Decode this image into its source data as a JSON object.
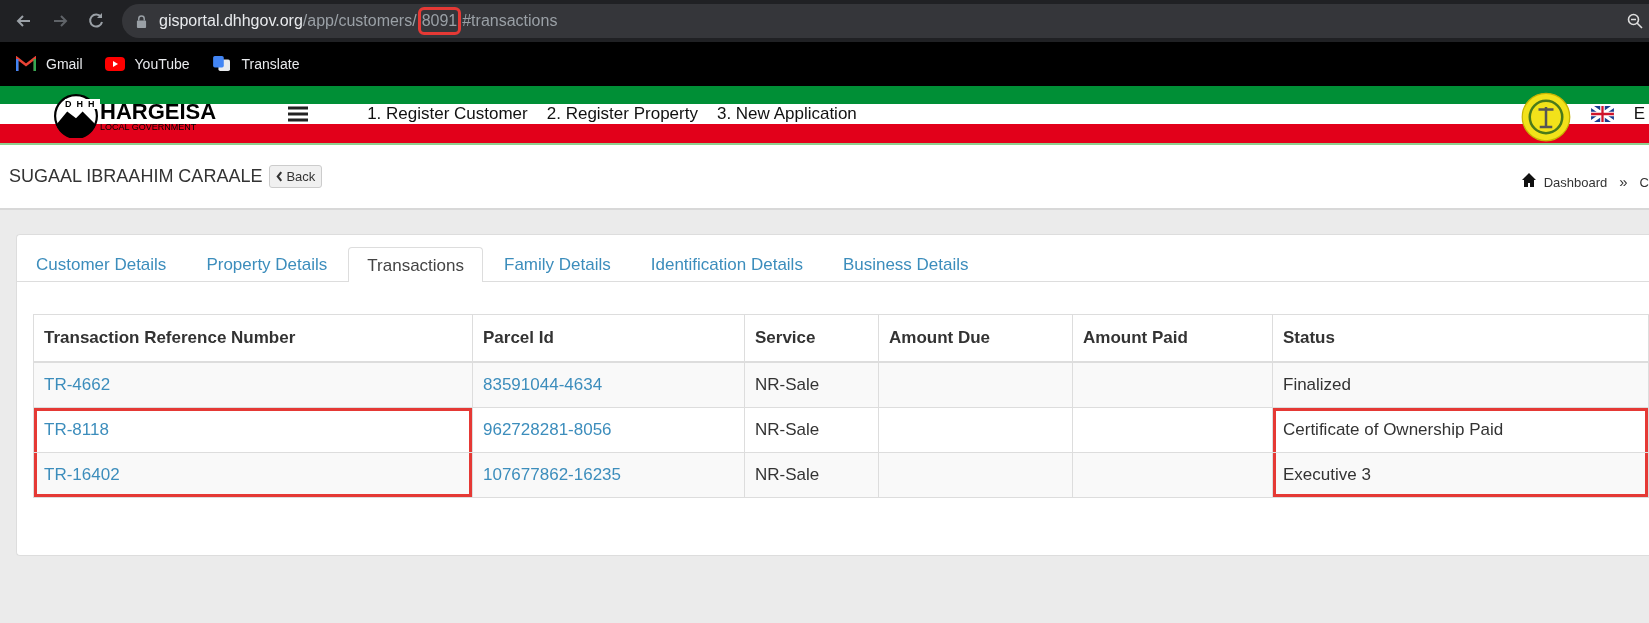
{
  "browser": {
    "url_host": "gisportal.dhhgov.org",
    "url_path_before": "/app/customers/",
    "url_highlight": "8091",
    "url_path_after": "#transactions",
    "bookmarks": [
      {
        "label": "Gmail",
        "kind": "gmail"
      },
      {
        "label": "YouTube",
        "kind": "youtube"
      },
      {
        "label": "Translate",
        "kind": "translate"
      }
    ]
  },
  "header": {
    "logo_top": "HARGEISA",
    "logo_bottom": "LOCAL GOVERNMENT",
    "logo_letters": "DHH",
    "nav": [
      "1. Register Customer",
      "2. Register Property",
      "3. New Application"
    ],
    "language": "E"
  },
  "page": {
    "title": "SUGAAL IBRAAHIM CARAALE",
    "back_button": "Back",
    "breadcrumb": [
      "Dashboard",
      "»",
      "C"
    ]
  },
  "tabs": [
    {
      "label": "Customer Details",
      "selected": false
    },
    {
      "label": "Property Details",
      "selected": false
    },
    {
      "label": "Transactions",
      "selected": true
    },
    {
      "label": "Family Details",
      "selected": false
    },
    {
      "label": "Identification Details",
      "selected": false
    },
    {
      "label": "Business Details",
      "selected": false
    }
  ],
  "table": {
    "columns": [
      "Transaction Reference Number",
      "Parcel Id",
      "Service",
      "Amount Due",
      "Amount Paid",
      "Status"
    ],
    "rows": [
      {
        "reference": "TR-4662",
        "parcel": "83591044-4634",
        "service": "NR-Sale",
        "amount_due": "",
        "amount_paid": "",
        "status": "Finalized",
        "highlighted": false
      },
      {
        "reference": "TR-8118",
        "parcel": "962728281-8056",
        "service": "NR-Sale",
        "amount_due": "",
        "amount_paid": "",
        "status": "Certificate of Ownership Paid",
        "highlighted": true
      },
      {
        "reference": "TR-16402",
        "parcel": "107677862-16235",
        "service": "NR-Sale",
        "amount_due": "",
        "amount_paid": "",
        "status": "Executive 3",
        "highlighted": true
      }
    ]
  }
}
